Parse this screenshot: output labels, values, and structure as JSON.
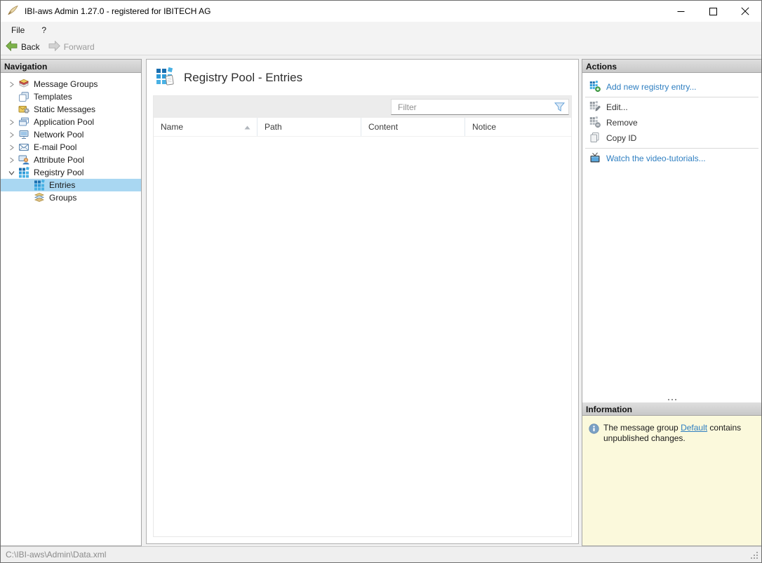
{
  "window": {
    "title": "IBI-aws Admin 1.27.0 - registered for IBITECH AG"
  },
  "menubar": {
    "items": [
      "File",
      "?"
    ]
  },
  "toolbar": {
    "back_label": "Back",
    "forward_label": "Forward"
  },
  "navigation": {
    "header": "Navigation",
    "items": [
      {
        "label": "Message Groups",
        "expandable": true,
        "expanded": false
      },
      {
        "label": "Templates",
        "expandable": false
      },
      {
        "label": "Static Messages",
        "expandable": false
      },
      {
        "label": "Application Pool",
        "expandable": true,
        "expanded": false
      },
      {
        "label": "Network Pool",
        "expandable": true,
        "expanded": false
      },
      {
        "label": "E-mail Pool",
        "expandable": true,
        "expanded": false
      },
      {
        "label": "Attribute Pool",
        "expandable": true,
        "expanded": false
      },
      {
        "label": "Registry Pool",
        "expandable": true,
        "expanded": true
      },
      {
        "label": "Entries",
        "selected": true,
        "level": 1
      },
      {
        "label": "Groups",
        "level": 1
      }
    ]
  },
  "content": {
    "title": "Registry Pool - Entries",
    "filter": {
      "placeholder": "Filter",
      "value": ""
    },
    "table": {
      "columns": [
        "Name",
        "Path",
        "Content",
        "Notice"
      ],
      "sort": {
        "column": "Name",
        "direction": "ascending"
      },
      "rows": []
    }
  },
  "actions": {
    "header": "Actions",
    "items": [
      {
        "label": "Add new registry entry...",
        "enabled": true
      },
      {
        "label": "Edit...",
        "enabled": false
      },
      {
        "label": "Remove",
        "enabled": false
      },
      {
        "label": "Copy ID",
        "enabled": false
      },
      {
        "label": "Watch the video-tutorials...",
        "enabled": true
      }
    ]
  },
  "information": {
    "header": "Information",
    "message": {
      "before": "The message group ",
      "link": "Default",
      "after": " contains unpublished changes."
    }
  },
  "statusbar": {
    "path": "C:\\IBI-aws\\Admin\\Data.xml"
  },
  "icons": {
    "app": "quill-icon",
    "back": "green-left-arrow-icon",
    "forward": "gray-right-arrow-icon",
    "registry": "blue-grid-icon",
    "filter": "funnel-icon",
    "information": "info-circle-icon"
  },
  "colors": {
    "selection": "#a9d7f2",
    "link": "#2f7fc1",
    "info_background": "#fbf9dc",
    "registry_dark_blue": "#1b6fb0",
    "registry_light_blue": "#49b1e4",
    "back_arrow_green": "#7cb24a"
  }
}
